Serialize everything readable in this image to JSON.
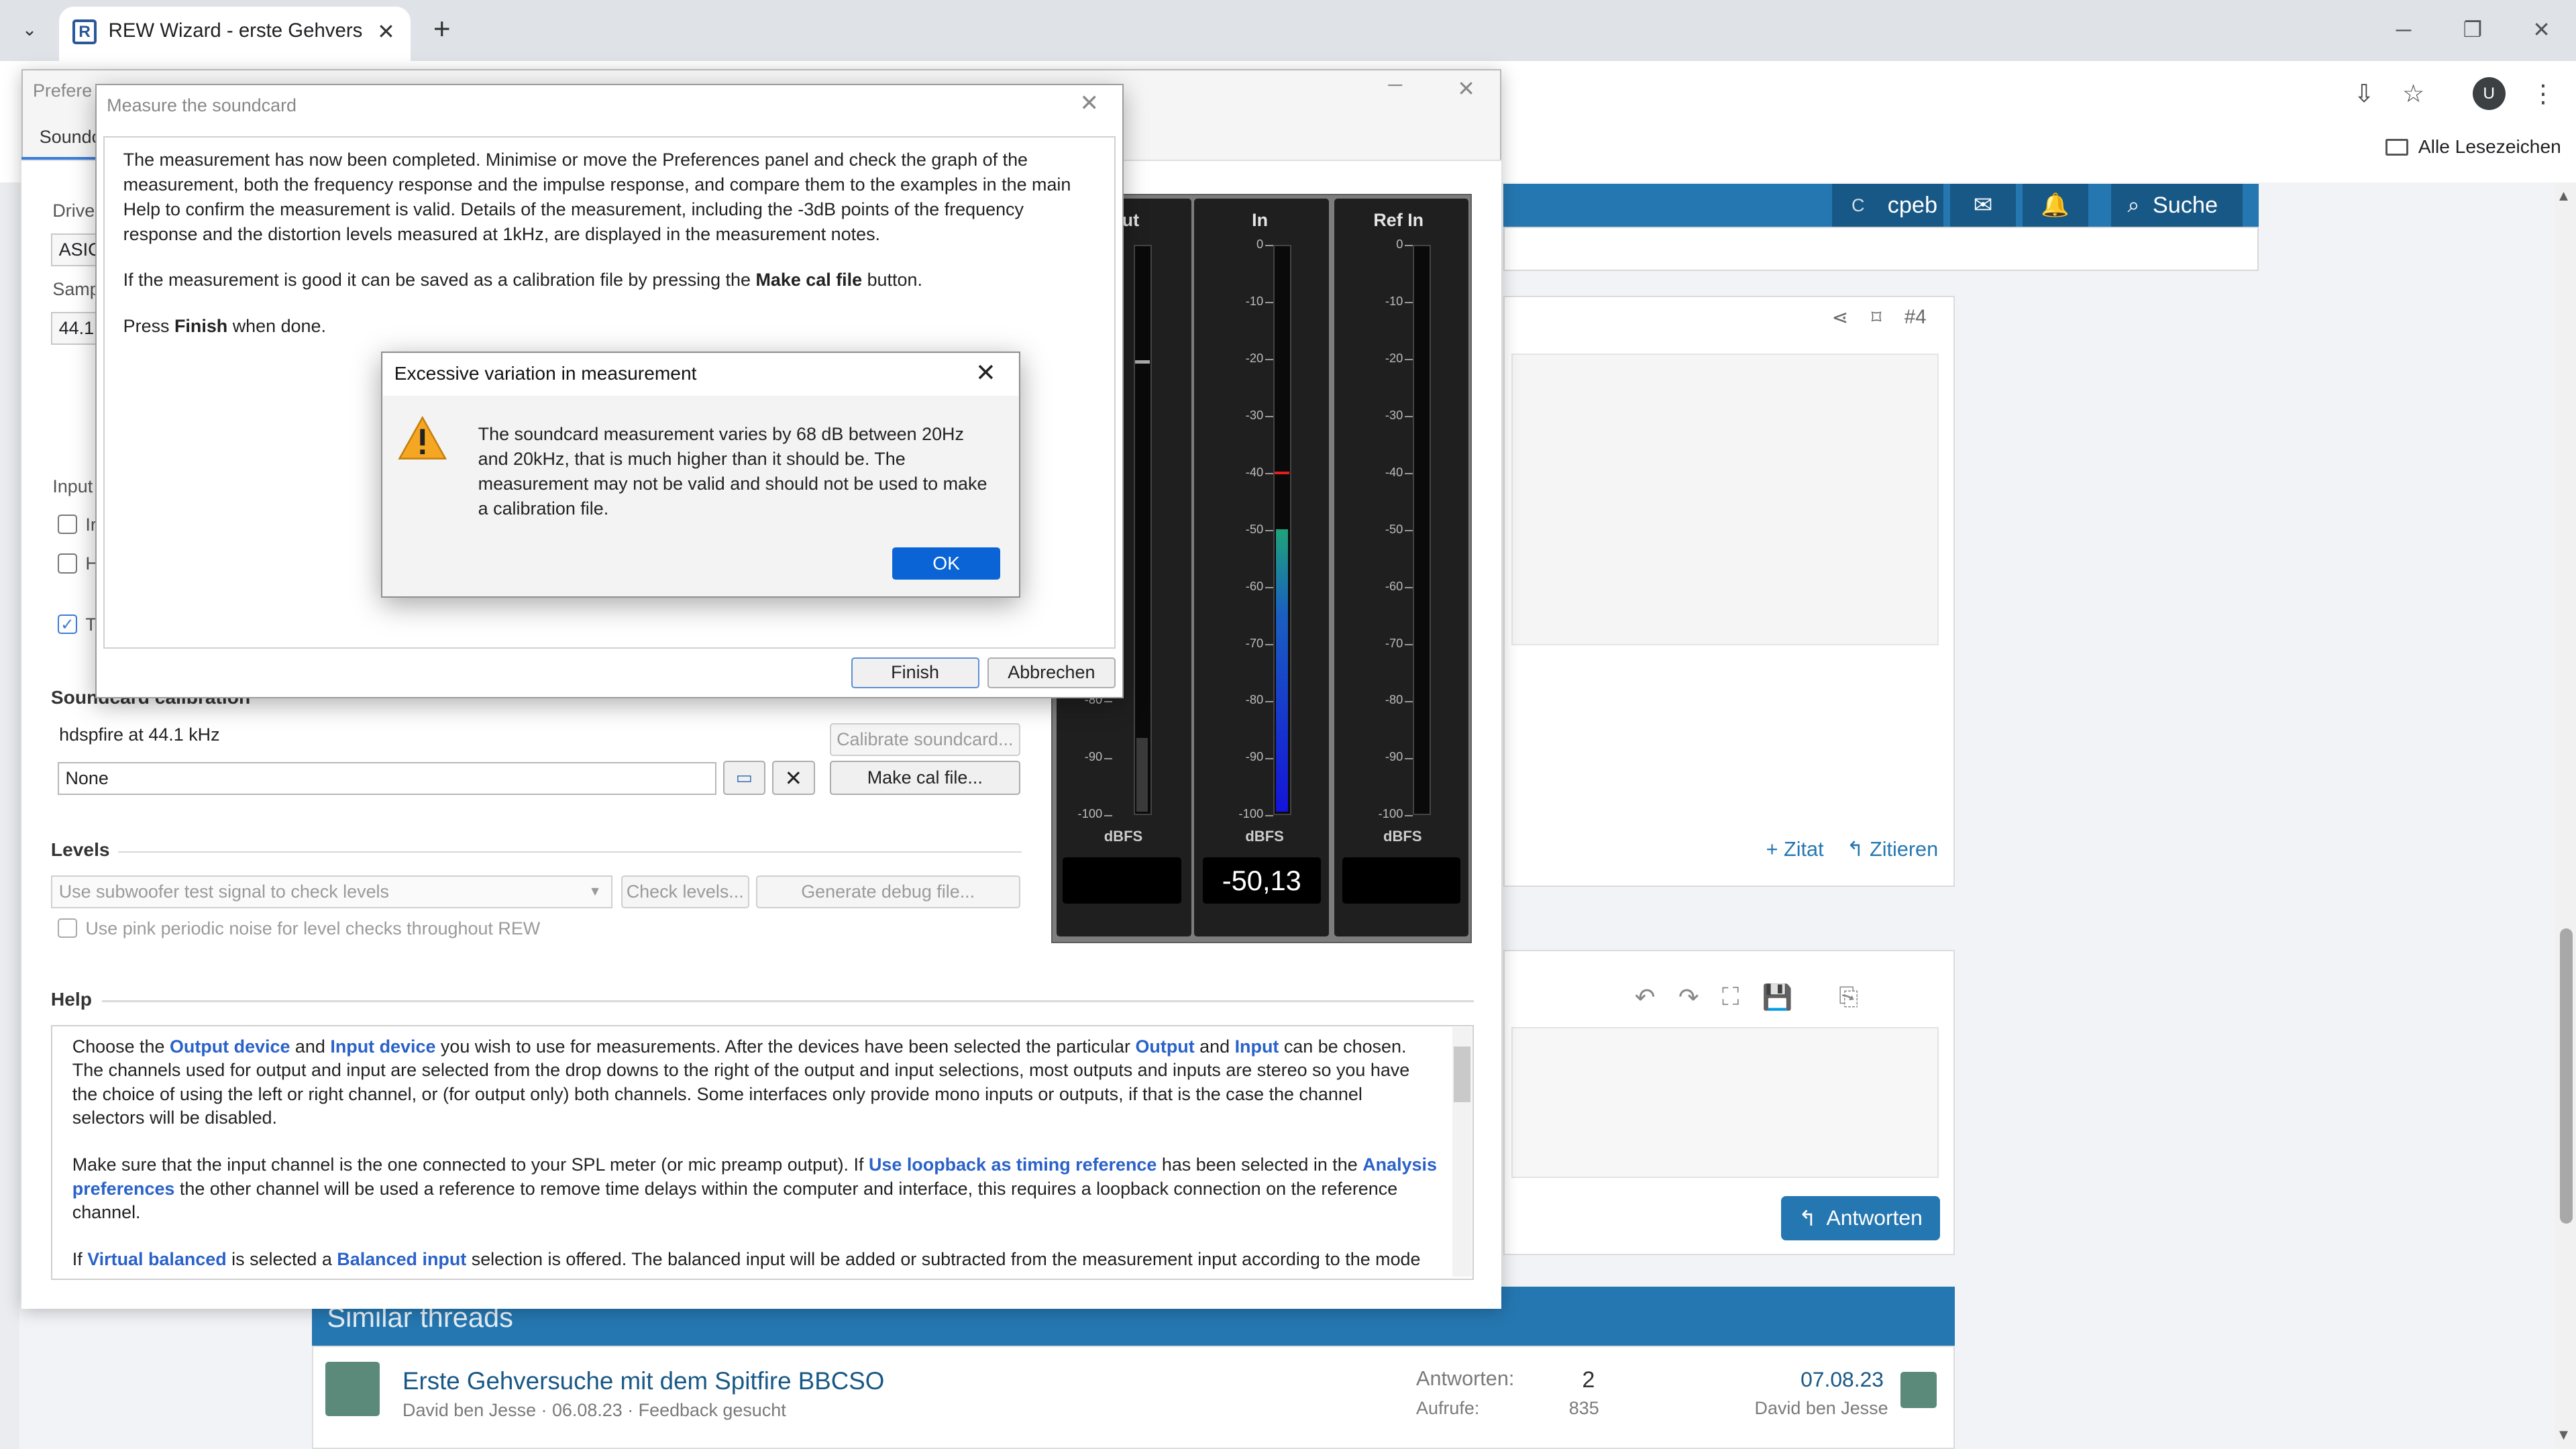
{
  "browser": {
    "tab_title": "REW Wizard - erste Gehversuch",
    "tab_favicon": "R",
    "avatar_letter": "U",
    "bookmarks_label": "Alle Lesezeichen"
  },
  "forum": {
    "user_initial": "C",
    "username": "cpeb",
    "search_label": "Suche",
    "post_number": "#4",
    "zitat_label": "+ Zitat",
    "zitieren_label": "↰ Zitieren",
    "reply_label": "Antworten",
    "similar_title": "Similar threads",
    "thread": {
      "title": "Erste Gehversuche mit dem Spitfire BBCSO",
      "meta": "David ben Jesse · 06.08.23 · Feedback gesucht",
      "replies_label": "Antworten:",
      "replies_value": "2",
      "views_label": "Aufrufe:",
      "views_value": "835",
      "last_date": "07.08.23",
      "last_user": "David ben Jesse"
    }
  },
  "prefs": {
    "title": "Prefere",
    "tab": "Soundc",
    "driver_label": "Drive",
    "driver_value": "ASIC",
    "sample_label": "Samp",
    "sample_value": "44.1",
    "input_label": "Input",
    "cb1": "Ir",
    "cb2": "H",
    "cb3": "T",
    "calibration_title": "Soundcard calibration",
    "calibration_device": "hdspfire at 44.1 kHz",
    "cal_file": "None",
    "calibrate_btn": "Calibrate soundcard...",
    "make_cal_btn": "Make cal file...",
    "levels_title": "Levels",
    "levels_select": "Use subwoofer test signal to check levels",
    "check_levels_btn": "Check levels...",
    "debug_btn": "Generate debug file...",
    "pink_noise": "Use pink periodic noise for level checks throughout REW",
    "help_title": "Help",
    "help": {
      "p1_a": "Choose the ",
      "p1_b": "Output device",
      "p1_c": " and ",
      "p1_d": "Input device",
      "p1_e": " you wish to use for measurements. After the devices have been selected the particular ",
      "p1_f": "Output",
      "p1_g": " and ",
      "p1_h": "Input",
      "p1_i": " can be chosen. The channels used for output and input are selected from the drop downs to the right of the output and input selections, most outputs and inputs are stereo so you have the choice of using the left or right channel, or (for output only) both channels. Some interfaces only provide mono inputs or outputs, if that is the case the channel selectors will be disabled.",
      "p2_a": "Make sure that the input channel is the one connected to your SPL meter (or mic preamp output). If ",
      "p2_b": "Use loopback as timing reference",
      "p2_c": " has been selected in the ",
      "p2_d": "Analysis preferences",
      "p2_e": " the other channel will be used a reference to remove time delays within the computer and interface, this requires a loopback connection on the reference channel.",
      "p3_a": "If ",
      "p3_b": "Virtual balanced",
      "p3_c": " is selected a ",
      "p3_d": "Balanced input",
      "p3_e": " selection is offered. The balanced input will be added or subtracted from the measurement input according to the mode"
    },
    "meters": {
      "out_title": "ut",
      "in_title": "In",
      "ref_title": "Ref In",
      "unit": "dBFS",
      "in_readout": "-50,13",
      "ticks": [
        "0",
        "-10",
        "-20",
        "-30",
        "-40",
        "-50",
        "-60",
        "-70",
        "-80",
        "-90",
        "-100"
      ],
      "in_level_db": -50.13,
      "in_peak_db": -39.5
    }
  },
  "measure": {
    "title": "Measure the soundcard",
    "p1": "The measurement has now been completed. Minimise or move the Preferences panel and check the graph of the measurement, both the frequency response and the impulse response, and compare them to the examples in the main Help to confirm the measurement is valid. Details of the measurement, including the -3dB points of the frequency response and the distortion levels measured at 1kHz, are displayed in the measurement notes.",
    "p2_a": "If the measurement is good it can be saved as a calibration file by pressing the ",
    "p2_b": "Make cal file",
    "p2_c": " button.",
    "p3_a": "Press ",
    "p3_b": "Finish",
    "p3_c": " when done.",
    "finish_btn": "Finish",
    "cancel_btn": "Abbrechen"
  },
  "alert": {
    "title": "Excessive variation in measurement",
    "message": "The soundcard measurement varies by 68 dB between 20Hz and 20kHz, that is much higher than it should be. The measurement may not be valid and should not be used to make a calibration file.",
    "ok_label": "OK"
  }
}
